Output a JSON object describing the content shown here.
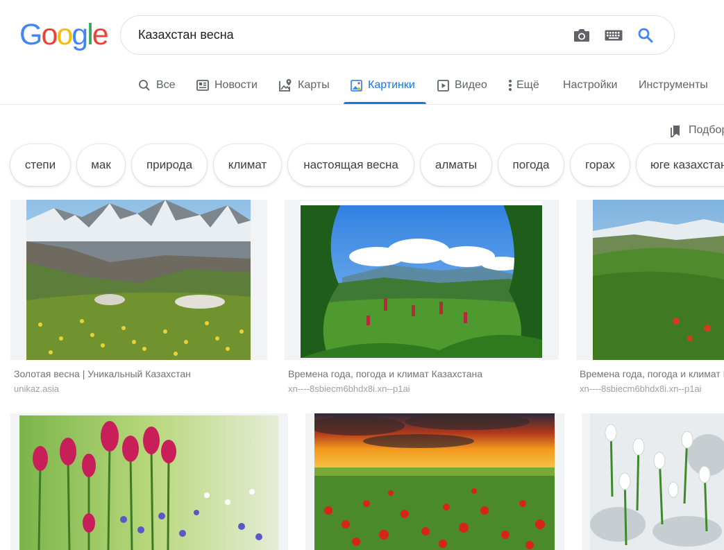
{
  "logo": {
    "letters": [
      "G",
      "o",
      "o",
      "g",
      "l",
      "e"
    ],
    "colors": [
      "#4285F4",
      "#EA4335",
      "#FBBC05",
      "#4285F4",
      "#34A853",
      "#EA4335"
    ]
  },
  "search": {
    "query": "Казахстан весна",
    "icons": [
      "camera-icon",
      "keyboard-icon",
      "search-icon"
    ]
  },
  "tabs": [
    {
      "label": "Все",
      "icon": "magnifier-icon",
      "active": false
    },
    {
      "label": "Новости",
      "icon": "newspaper-icon",
      "active": false
    },
    {
      "label": "Карты",
      "icon": "map-pin-icon",
      "active": false
    },
    {
      "label": "Картинки",
      "icon": "image-icon",
      "active": true
    },
    {
      "label": "Видео",
      "icon": "play-icon",
      "active": false
    },
    {
      "label": "Ещё",
      "icon": "more-vert-icon",
      "active": false
    },
    {
      "label": "Настройки",
      "active": false
    },
    {
      "label": "Инструменты",
      "active": false
    }
  ],
  "collection_label": "Подборки",
  "chips": [
    "степи",
    "мак",
    "природа",
    "климат",
    "настоящая весна",
    "алматы",
    "погода",
    "горах",
    "юге казахстана"
  ],
  "results": [
    {
      "title": "Золотая весна | Уникальный Казахстан",
      "source": "unikaz.asia",
      "scene": "mountain-meadow"
    },
    {
      "title": "Времена года, погода и климат Казахстана",
      "source": "xn----8sbiecm6bhdx8i.xn--p1ai",
      "scene": "framed-valley"
    },
    {
      "title": "Времена года, погода и климат Казахстана",
      "source": "xn----8sbiecm6bhdx8i.xn--p1ai",
      "scene": "green-hills"
    },
    {
      "title": "",
      "source": "",
      "scene": "tulips"
    },
    {
      "title": "",
      "source": "",
      "scene": "sunset-poppies"
    },
    {
      "title": "",
      "source": "",
      "scene": "snowdrops"
    }
  ],
  "colors": {
    "accent": "#1a73e8",
    "muted": "#5f6368",
    "border": "#dfe1e5"
  }
}
